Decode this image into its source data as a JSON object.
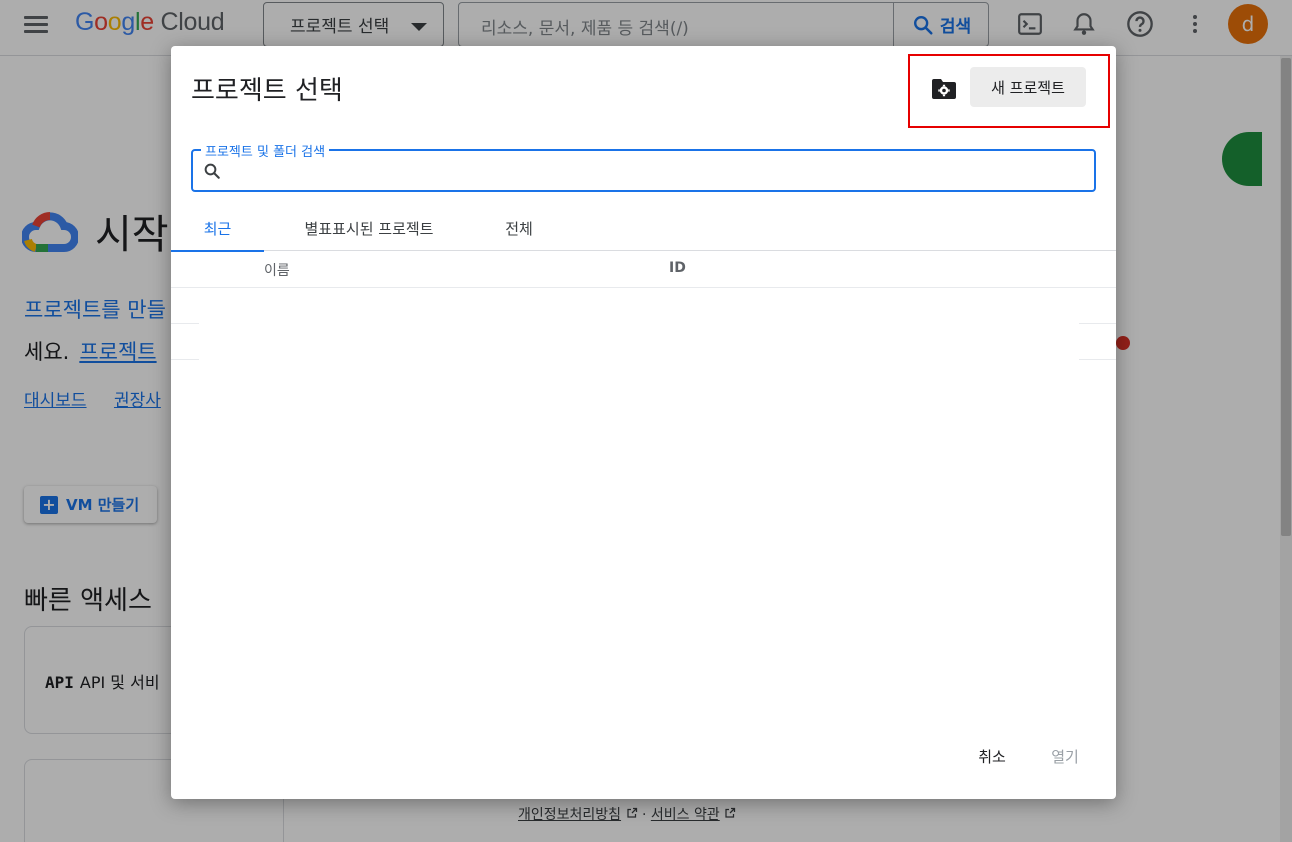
{
  "topbar": {
    "logo_google": "Google",
    "logo_cloud": "Cloud",
    "project_select_label": "프로젝트 선택",
    "search_placeholder": "리소스, 문서, 제품 등 검색(/)",
    "search_button_label": "검색",
    "avatar_letter": "d"
  },
  "background": {
    "title": "시작",
    "link_line1": "프로젝트를 만들",
    "line2_text": "세요.",
    "line2_link": "프로젝트",
    "links": [
      "대시보드",
      "권장사"
    ],
    "vm_button": "VM 만들기",
    "quick_access_title": "빠른 액세스",
    "card1_prefix": "API",
    "card1_text": "API 및 서비",
    "footer_privacy": "개인정보처리방침",
    "footer_sep": "·",
    "footer_terms": "서비스 약관"
  },
  "dialog": {
    "title": "프로젝트 선택",
    "new_project_button": "새 프로젝트",
    "search_label": "프로젝트 및 폴더 검색",
    "search_value": "",
    "tabs": [
      {
        "label": "최근",
        "active": true
      },
      {
        "label": "별표표시된 프로젝트",
        "active": false
      },
      {
        "label": "전체",
        "active": false
      }
    ],
    "columns": {
      "name": "이름",
      "id": "ID"
    },
    "cancel_button": "취소",
    "open_button": "열기"
  },
  "colors": {
    "accent": "#1a73e8",
    "avatar": "#e8710a",
    "highlight": "#e60000"
  }
}
